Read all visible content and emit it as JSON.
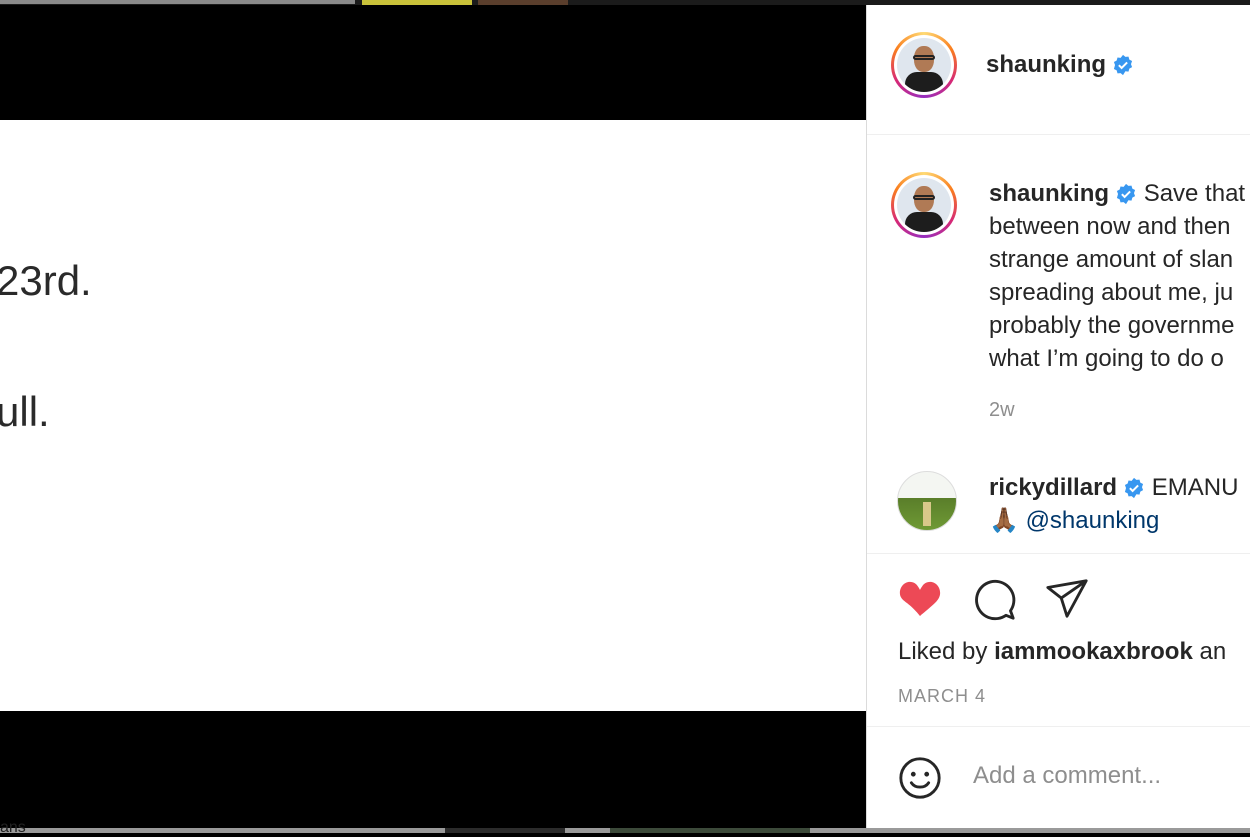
{
  "post": {
    "text_lines": [
      "23rd.",
      "ull."
    ]
  },
  "header": {
    "username": "shaunking"
  },
  "caption": {
    "username": "shaunking",
    "lines": [
      "Save that",
      "between now and then",
      "strange amount of slan",
      "spreading about me, ju",
      "probably the governme",
      "what I’m going to do o"
    ],
    "time": "2w"
  },
  "comment": {
    "username": "rickydillard",
    "text": "EMANU",
    "emoji": "🙏🏾",
    "mention": "@shaunking"
  },
  "actions": {
    "liked_by_prefix": "Liked by ",
    "liked_by_user": "iammookaxbrook",
    "liked_by_suffix": " an",
    "date": "MARCH 4"
  },
  "add_comment": {
    "placeholder": "Add a comment..."
  },
  "background": {
    "bottom_label": "ans"
  },
  "colors": {
    "like_red": "#ed4956",
    "verified_blue": "#3897f0",
    "link_blue": "#00376b"
  },
  "icons": [
    "heart-icon",
    "comment-icon",
    "share-icon",
    "emoji-icon",
    "verified-badge-icon"
  ]
}
